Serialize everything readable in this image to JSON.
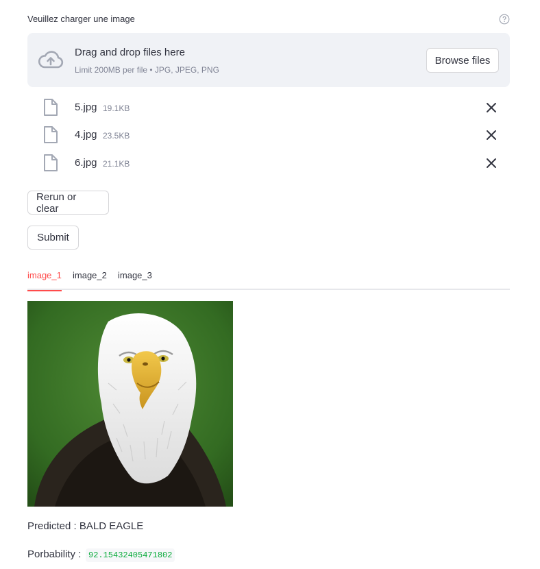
{
  "uploader": {
    "label": "Veuillez charger une image",
    "dropzone_title": "Drag and drop files here",
    "dropzone_limit": "Limit 200MB per file • JPG, JPEG, PNG",
    "browse_label": "Browse files",
    "icons": {
      "help": "help-circle-icon",
      "upload": "cloud-upload-icon",
      "file": "file-icon",
      "remove": "close-icon"
    }
  },
  "files": [
    {
      "name": "5.jpg",
      "size": "19.1KB"
    },
    {
      "name": "4.jpg",
      "size": "23.5KB"
    },
    {
      "name": "6.jpg",
      "size": "21.1KB"
    }
  ],
  "buttons": {
    "rerun_label": "Rerun or clear",
    "submit_label": "Submit"
  },
  "tabs": [
    {
      "label": "image_1",
      "active": true
    },
    {
      "label": "image_2",
      "active": false
    },
    {
      "label": "image_3",
      "active": false
    }
  ],
  "result": {
    "predicted_text": "Predicted : BALD EAGLE",
    "probability_label": "Porbability :",
    "probability_value": "92.15432405471802"
  },
  "colors": {
    "accent": "#ff4b4b",
    "dropzone_bg": "#f0f2f6",
    "code_green": "#09ab3b",
    "muted_text": "#808495"
  }
}
